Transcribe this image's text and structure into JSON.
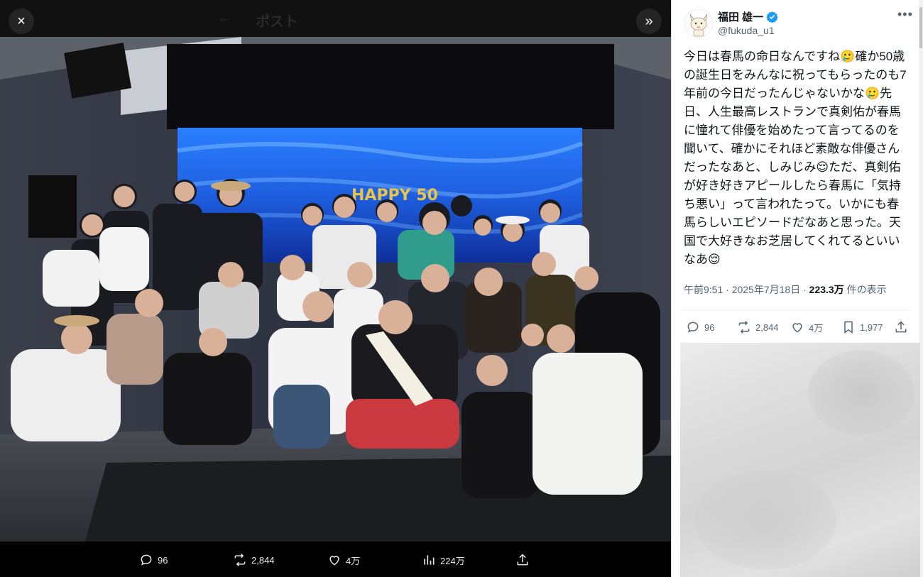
{
  "viewer": {
    "header_title": "ポスト",
    "close_label": "×",
    "expand_label": "»",
    "back_label": "←"
  },
  "photo": {
    "banner_text": "HAPPY 50"
  },
  "media_actions": {
    "reply_count": "96",
    "repost_count": "2,844",
    "like_count": "4万",
    "views_count": "224万"
  },
  "author": {
    "name": "福田 雄一",
    "handle": "@fukuda_u1",
    "verified_color": "#1d9bf0"
  },
  "tweet": {
    "text": "今日は春馬の命日なんですね🥲確か50歳の誕生日をみんなに祝ってもらったのも7年前の今日だったんじゃないかな🥲先日、人生最高レストランで真剣佑が春馬に憧れて俳優を始めたって言ってるのを聞いて、確かにそれほど素敵な俳優さんだったなあと、しみじみ😌ただ、真剣佑が好き好きアピールしたら春馬に「気持ち悪い」って言われたって。いかにも春馬らしいエピソードだなあと思った。天国で大好きなお芝居してくれてるといいなあ😌"
  },
  "meta": {
    "time": "午前9:51",
    "sep1": " · ",
    "date": "2025年7月18日",
    "sep2": " · ",
    "views": "223.3万",
    "views_suffix": " 件の表示"
  },
  "stats": {
    "reply_count": "96",
    "repost_count": "2,844",
    "like_count": "4万",
    "bookmark_count": "1,977"
  }
}
